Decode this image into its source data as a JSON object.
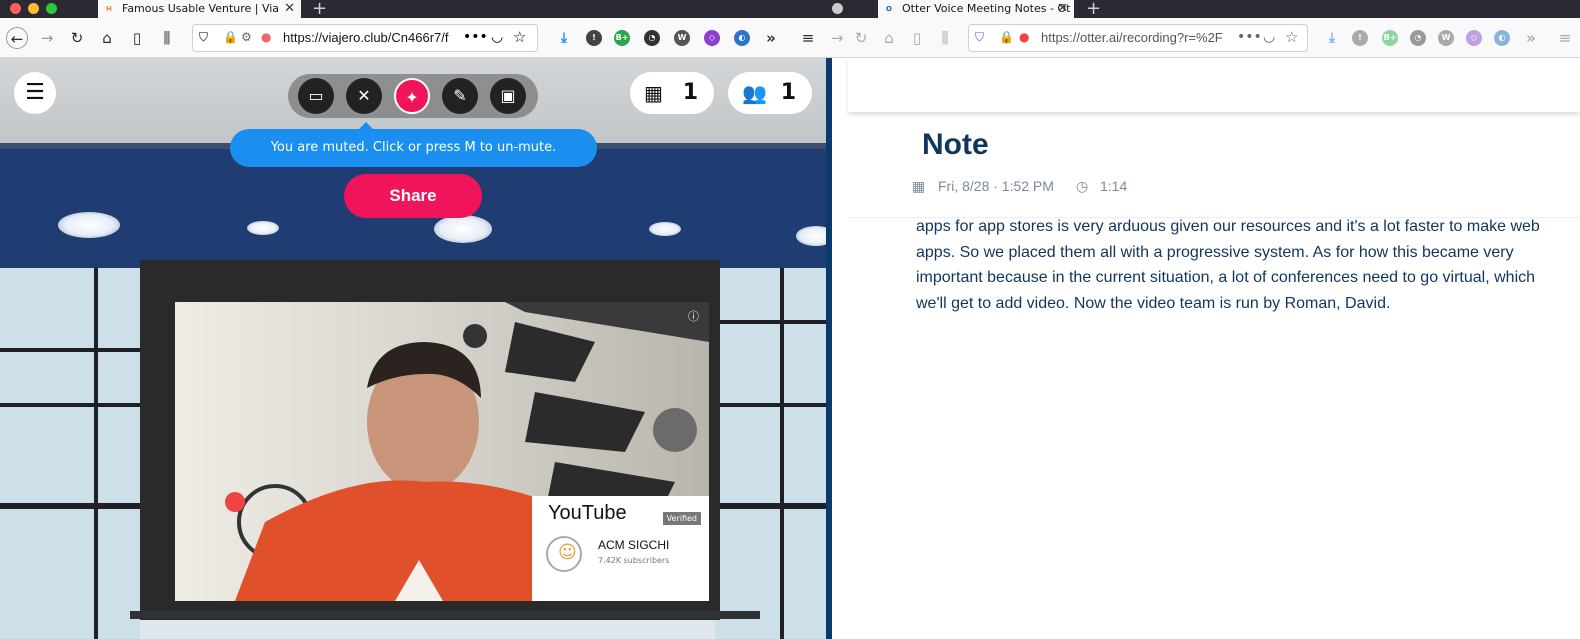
{
  "left_browser": {
    "tab_title": "Famous Usable Venture | Via",
    "url": "https://viajero.club/Cn466r7/f"
  },
  "right_browser": {
    "tab_title": "Otter Voice Meeting Notes - Ot",
    "url": "https://otter.ai/recording?r=%2F"
  },
  "hubs": {
    "menu_icon": "hamburger-icon",
    "toolbar_icons": [
      "screen-share-icon",
      "mic-muted-icon",
      "magic-wand-icon",
      "pen-icon",
      "camera-icon"
    ],
    "objects_count": "1",
    "people_count": "1",
    "mute_tooltip": "You are muted. Click or press M to un-mute.",
    "share_label": "Share"
  },
  "video": {
    "platform": "YouTube",
    "badge": "Verified",
    "channel": "ACM SIGCHI",
    "subscribers": "7.42K subscribers"
  },
  "otter": {
    "title": "Note",
    "date": "Fri, 8/28 · 1:52 PM",
    "duration": "1:14",
    "transcript": "apps for app stores is very arduous given our resources and it's a lot faster to make web apps. So we placed them all with a progressive system. As for how this became very important because in the current situation, a lot of conferences need to go virtual, which we'll get to add video. Now the video team is run by Roman, David."
  },
  "colors": {
    "share": "#f0145a",
    "tooltip": "#1a8ff0",
    "otter_text": "#10365d"
  }
}
